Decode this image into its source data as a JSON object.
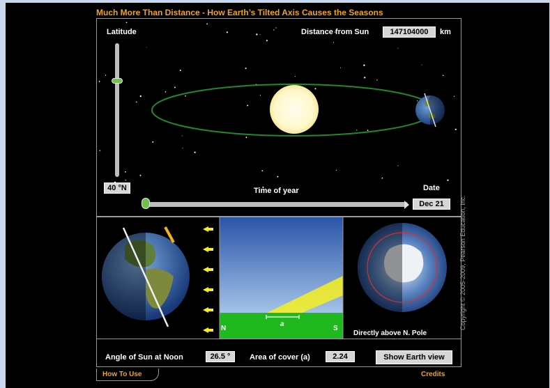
{
  "title": "Much More Than Distance - How Earth’s Tilted Axis Causes the Seasons",
  "latitude": {
    "label": "Latitude",
    "value": "40 °N",
    "level_fraction": 0.28
  },
  "distance": {
    "label": "Distance from Sun",
    "value": "147104000",
    "unit": "km"
  },
  "time_of_year": {
    "label": "Time of year",
    "date_label": "Date",
    "date_value": "Dec 21",
    "progress_fraction": 0.0
  },
  "sun_panel": {
    "bottom_left": "N",
    "bottom_right": "S",
    "area_marker": "a"
  },
  "pole_view": {
    "caption": "Directly above N. Pole"
  },
  "controls": {
    "angle_label": "Angle of Sun at Noon",
    "angle_value": "26.5 °",
    "area_label": "Area of cover (a)",
    "area_value": "2.24",
    "earth_view_button": "Show Earth view"
  },
  "footer": {
    "how_to_use": "How To Use",
    "credits": "Credits",
    "copyright": "Copyright © 2005-2009, Pearson Education, Inc."
  },
  "colors": {
    "accent": "#f0a31c",
    "orbit": "#1f8a2a",
    "sun": "#fffbd0",
    "ground": "#1fb81f",
    "sunbeam": "#f6f020",
    "sky_top": "#2a54a8",
    "sky_bottom": "#c6e2fa"
  }
}
